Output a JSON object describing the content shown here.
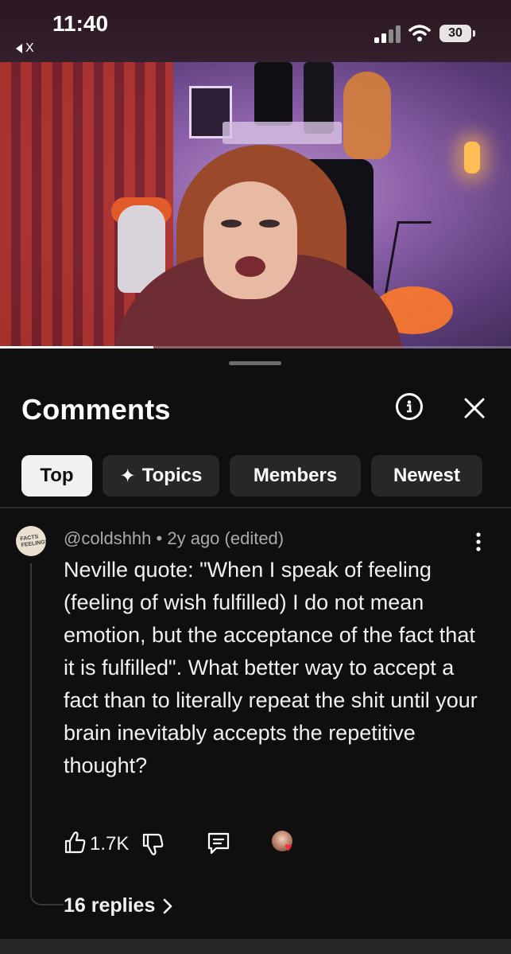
{
  "status_bar": {
    "time": "11:40",
    "back_app_label": "X",
    "battery": "30",
    "icons": [
      "cellular-signal-icon",
      "wifi-icon",
      "battery-icon"
    ]
  },
  "video": {
    "progress_fraction": 0.3
  },
  "comments_panel": {
    "title": "Comments",
    "icons": [
      "info-icon",
      "close-icon"
    ],
    "chips": [
      {
        "label": "Top",
        "active": true
      },
      {
        "label": "Topics",
        "icon": "sparkle-icon",
        "active": false
      },
      {
        "label": "Members",
        "active": false
      },
      {
        "label": "Newest",
        "active": false
      }
    ]
  },
  "comment": {
    "author": "@coldshhh",
    "separator": "•",
    "time": "2y ago (edited)",
    "avatar_text": "FACTS FEELINGS",
    "text": "Neville quote: \"When I speak of feeling (feeling of wish fulfilled) I do not mean emotion, but the acceptance of the fact that it is fulfilled\". What better way to accept a fact than to literally repeat the shit until your brain inevitably accepts the repetitive thought?",
    "likes": "1.7K",
    "replies_label": "16 replies",
    "action_icons": [
      "thumbs-up-icon",
      "thumbs-down-icon",
      "reply-icon",
      "creator-heart-icon",
      "more-vert-icon"
    ]
  },
  "colors": {
    "background": "#0f0f0f",
    "chip_bg": "#272727",
    "chip_active_bg": "#f1f1f1",
    "meta_text": "#aaaaaa",
    "heart": "#ff2d3c"
  }
}
